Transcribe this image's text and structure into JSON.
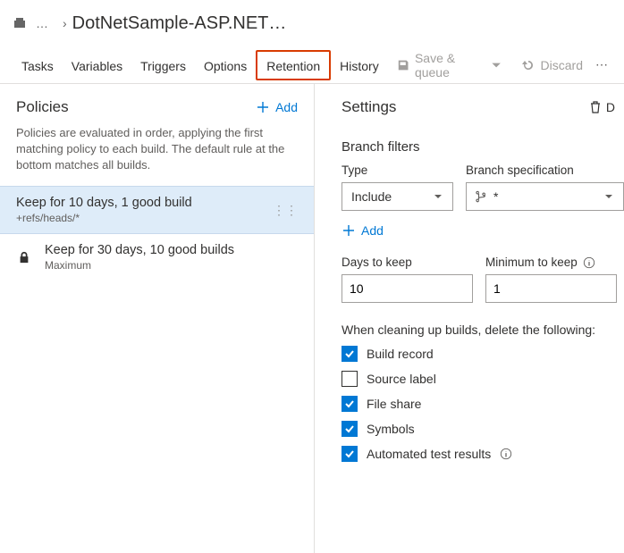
{
  "breadcrumb": {
    "title": "DotNetSample-ASP.NET…"
  },
  "tabs": {
    "tasks": "Tasks",
    "variables": "Variables",
    "triggers": "Triggers",
    "options": "Options",
    "retention": "Retention",
    "history": "History"
  },
  "toolbar": {
    "save_queue": "Save & queue",
    "discard": "Discard"
  },
  "policies": {
    "heading": "Policies",
    "add": "Add",
    "description": "Policies are evaluated in order, applying the first matching policy to each build. The default rule at the bottom matches all builds.",
    "items": [
      {
        "title": "Keep for 10 days, 1 good build",
        "subtitle": "+refs/heads/*"
      },
      {
        "title": "Keep for 30 days, 10 good builds",
        "subtitle": "Maximum"
      }
    ]
  },
  "settings": {
    "heading": "Settings",
    "delete_partial": "D",
    "branch_filters_heading": "Branch filters",
    "type_label": "Type",
    "type_value": "Include",
    "branch_spec_label": "Branch specification",
    "branch_spec_value": "*",
    "add": "Add",
    "days_label": "Days to keep",
    "days_value": "10",
    "minimum_label": "Minimum to keep",
    "minimum_value": "1",
    "cleanup_heading": "When cleaning up builds, delete the following:",
    "cb_build_record": "Build record",
    "cb_source_label": "Source label",
    "cb_file_share": "File share",
    "cb_symbols": "Symbols",
    "cb_automated": "Automated test results"
  }
}
